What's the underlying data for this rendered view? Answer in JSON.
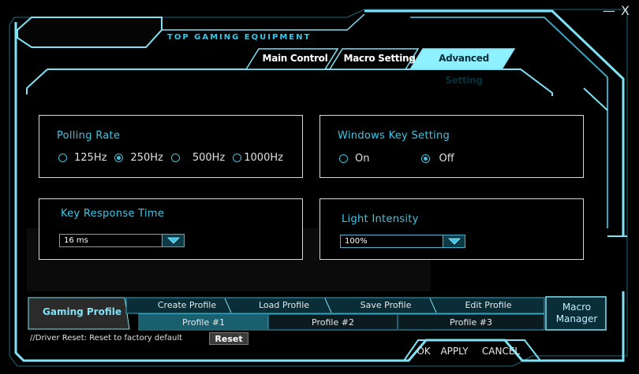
{
  "window": {
    "minimize": "—",
    "close": "X"
  },
  "brand": "TOP GAMING EQUIPMENT",
  "tabs": [
    {
      "label": "Main Control",
      "active": false
    },
    {
      "label": "Macro Setting",
      "active": false
    },
    {
      "label": "Advanced Setting",
      "active": true
    }
  ],
  "polling": {
    "title": "Polling Rate",
    "options": [
      "125Hz",
      "250Hz",
      "500Hz",
      "1000Hz"
    ],
    "selected": "250Hz"
  },
  "winkey": {
    "title": "Windows Key Setting",
    "options": [
      "On",
      "Off"
    ],
    "selected": "Off"
  },
  "response": {
    "title": "Key Response Time",
    "value": "16 ms"
  },
  "light": {
    "title": "Light Intensity",
    "value": "100%"
  },
  "profiles": {
    "gaming_label": "Gaming Profile",
    "actions": [
      "Create Profile",
      "Load Profile",
      "Save Profile",
      "Edit Profile"
    ],
    "list": [
      "Profile #1",
      "Profile #2",
      "Profile #3"
    ],
    "selected": "Profile #1",
    "macro_manager": "Macro Manager"
  },
  "footer": {
    "reset_note": "//Driver Reset: Reset to factory default",
    "reset_button": "Reset",
    "ok": "OK",
    "apply": "APPLY",
    "cancel": "CANCEL"
  },
  "colors": {
    "accent": "#3cc7e6",
    "frame": "#7fe3f5",
    "panel_border": "#d8d8d8"
  }
}
